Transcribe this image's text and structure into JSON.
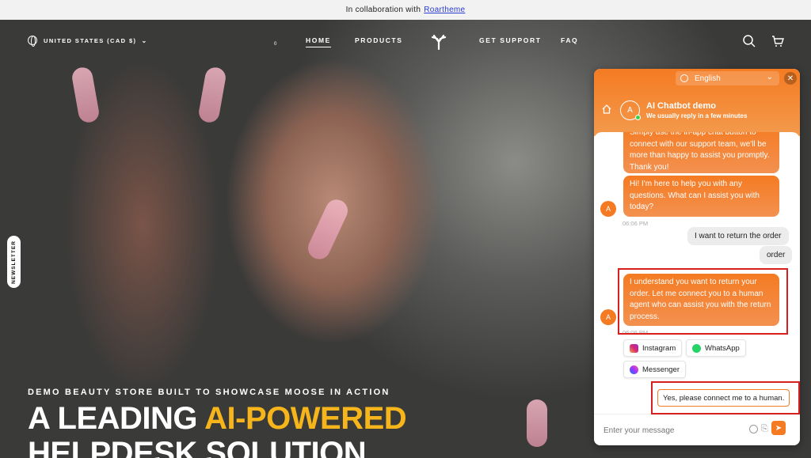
{
  "announcement": {
    "text": "In collaboration with",
    "link": "Roartheme"
  },
  "nav": {
    "locale": "UNITED STATES (CAD $)",
    "home": "HOME",
    "products": "PRODUCTS",
    "support": "GET SUPPORT",
    "faq": "FAQ",
    "cart_count": "0"
  },
  "newsletter": "NEWSLETTER",
  "hero": {
    "subtitle": "DEMO BEAUTY STORE BUILT TO SHOWCASE MOOSE IN ACTION",
    "title_plain": "A LEADING ",
    "title_accent": "AI-POWERED",
    "title_line2": "HELPDESK SOLUTION"
  },
  "chat": {
    "language": "English",
    "bot_name": "AI Chatbot demo",
    "status": "We usually reply in a few minutes",
    "avatar_letter": "A",
    "messages": {
      "m1": "Simply use the in-app chat button to connect with our support team, we'll be more than happy to assist you promptly. Thank you!",
      "m2": "Hi! I'm here to help you with any questions. What can I assist you with today?",
      "t1": "06:06 PM",
      "u1": "I want to return the order",
      "u2": "order",
      "m3": "I understand you want to return your order. Let me connect you to a human agent who can assist you with the return process.",
      "t2": "06:06 PM"
    },
    "chips": {
      "instagram": "Instagram",
      "whatsapp": "WhatsApp",
      "messenger": "Messenger"
    },
    "quick_reply": "Yes, please connect me to a human.",
    "input_placeholder": "Enter your message"
  },
  "colors": {
    "accent": "#f47b22",
    "hero_accent": "#f5b51b",
    "highlight": "#d61f1f"
  }
}
